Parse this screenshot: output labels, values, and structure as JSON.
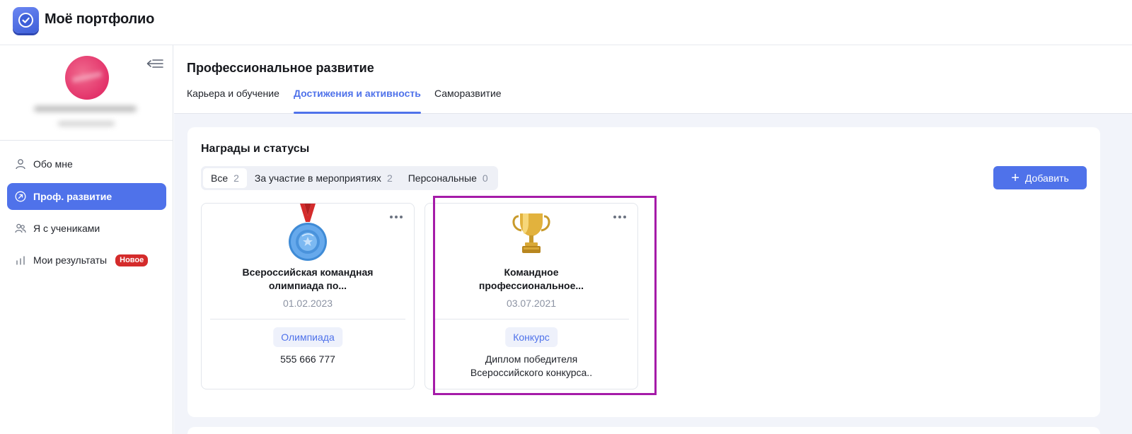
{
  "app": {
    "title": "Моё портфолио"
  },
  "sidebar": {
    "items": [
      {
        "label": "Обо мне",
        "icon": "user-icon",
        "active": false
      },
      {
        "label": "Проф. развитие",
        "icon": "arrow-circle-icon",
        "active": true
      },
      {
        "label": "Я с учениками",
        "icon": "users-icon",
        "active": false
      },
      {
        "label": "Мои результаты",
        "icon": "bar-chart-icon",
        "active": false,
        "badge": "Новое"
      }
    ]
  },
  "main": {
    "title": "Профессиональное развитие",
    "tabs": [
      {
        "label": "Карьера и обучение",
        "active": false
      },
      {
        "label": "Достижения и активность",
        "active": true
      },
      {
        "label": "Саморазвитие",
        "active": false
      }
    ],
    "section": {
      "title": "Награды и статусы",
      "filters": [
        {
          "label": "Все",
          "count": "2",
          "active": true
        },
        {
          "label": "За участие в мероприятиях",
          "count": "2",
          "active": false
        },
        {
          "label": "Персональные",
          "count": "0",
          "active": false
        }
      ],
      "add_label": "Добавить",
      "cards": [
        {
          "icon": "medal-icon",
          "title_line1": "Всероссийская командная",
          "title_line2": "олимпиада по...",
          "date": "01.02.2023",
          "tag": "Олимпиада",
          "desc_line1": "555 666 777",
          "desc_line2": ""
        },
        {
          "icon": "trophy-icon",
          "title_line1": "Командное",
          "title_line2": "профессиональное...",
          "date": "03.07.2021",
          "tag": "Конкурс",
          "desc_line1": "Диплом победителя",
          "desc_line2": "Всероссийского конкурса.."
        }
      ]
    }
  },
  "colors": {
    "accent": "#4f72ea",
    "badge": "#d42b2b",
    "highlight": "#a51ba8",
    "background": "#f2f4fa"
  }
}
